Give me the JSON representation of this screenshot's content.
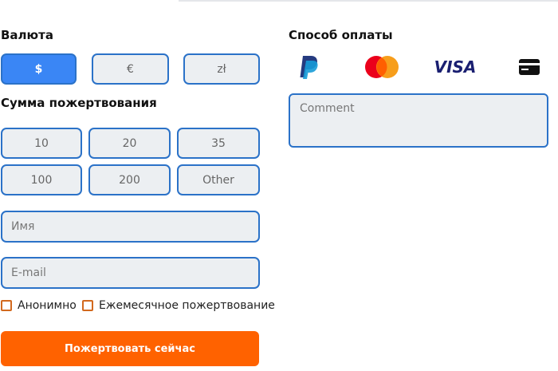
{
  "currency": {
    "heading": "Валюта",
    "options": [
      "$",
      "€",
      "zł"
    ],
    "selected": "$"
  },
  "amount": {
    "heading": "Сумма пожертвования",
    "options": [
      "10",
      "20",
      "35",
      "100",
      "200",
      "Other"
    ]
  },
  "form": {
    "name_placeholder": "Имя",
    "email_placeholder": "E-mail",
    "anonymous_label": "Анонимно",
    "monthly_label": "Ежемесячное пожертвование",
    "submit_label": "Пожертвовать сейчас"
  },
  "payment": {
    "heading": "Способ оплаты",
    "methods": [
      "paypal-icon",
      "mastercard-icon",
      "visa-icon",
      "card-icon"
    ],
    "visa_text": "VISA",
    "comment_placeholder": "Comment"
  },
  "colors": {
    "accent_blue": "#2b72c8",
    "selected_blue": "#3a86f5",
    "submit_orange": "#ff6200",
    "checkbox_orange": "#d2691e",
    "field_bg": "#eceff2"
  }
}
